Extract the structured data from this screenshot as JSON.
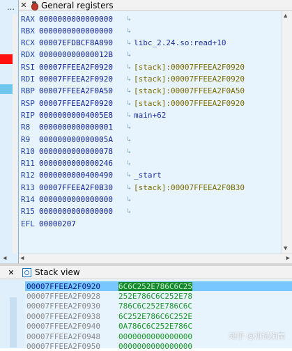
{
  "registers_panel": {
    "title": "General registers",
    "rows": [
      {
        "name": "RAX",
        "value": "0000000000000000",
        "note": ""
      },
      {
        "name": "RBX",
        "value": "0000000000000000",
        "note": ""
      },
      {
        "name": "RCX",
        "value": "00007EFDBCF8A890",
        "note": "libc_2.24.so:read+10"
      },
      {
        "name": "RDX",
        "value": "000000000000012B",
        "note": ""
      },
      {
        "name": "RSI",
        "value": "00007FFEEA2F0920",
        "note": "[stack]:00007FFEEA2F0920"
      },
      {
        "name": "RDI",
        "value": "00007FFEEA2F0920",
        "note": "[stack]:00007FFEEA2F0920"
      },
      {
        "name": "RBP",
        "value": "00007FFEEA2F0A50",
        "note": "[stack]:00007FFEEA2F0A50"
      },
      {
        "name": "RSP",
        "value": "00007FFEEA2F0920",
        "note": "[stack]:00007FFEEA2F0920"
      },
      {
        "name": "RIP",
        "value": "00000000004005E8",
        "note": "main+62"
      },
      {
        "name": "R8",
        "value": "0000000000000001",
        "note": ""
      },
      {
        "name": "R9",
        "value": "000000000000005A",
        "note": ""
      },
      {
        "name": "R10",
        "value": "0000000000000078",
        "note": ""
      },
      {
        "name": "R11",
        "value": "0000000000000246",
        "note": ""
      },
      {
        "name": "R12",
        "value": "0000000000400490",
        "note": "_start"
      },
      {
        "name": "R13",
        "value": "00007FFEEA2F0B30",
        "note": "[stack]:00007FFEEA2F0B30"
      },
      {
        "name": "R14",
        "value": "0000000000000000",
        "note": ""
      },
      {
        "name": "R15",
        "value": "0000000000000000",
        "note": ""
      },
      {
        "name": "EFL",
        "value": "00000207",
        "note": ""
      }
    ]
  },
  "stack_panel": {
    "title": "Stack view",
    "rows": [
      {
        "addr": "00007FFEEA2F0920",
        "value": "6C6C252E786C6C25"
      },
      {
        "addr": "00007FFEEA2F0928",
        "value": "252E786C6C252E78"
      },
      {
        "addr": "00007FFEEA2F0930",
        "value": "786C6C252E786C6C"
      },
      {
        "addr": "00007FFEEA2F0938",
        "value": "6C252E786C6C252E"
      },
      {
        "addr": "00007FFEEA2F0940",
        "value": "0A786C6C252E786C"
      },
      {
        "addr": "00007FFEEA2F0948",
        "value": "0000000000000000"
      },
      {
        "addr": "00007FFEEA2F0950",
        "value": "0000000000000000"
      }
    ]
  },
  "colors": {
    "selection": "#79c7ff",
    "highlight_value_bg": "#138a2c",
    "panel_bg": "#e8f4fd",
    "marker_red": "#ff1111",
    "marker_blue": "#6fc6ef"
  },
  "watermark": "知乎 @测试狗南",
  "icons": {
    "registers": "bug-icon",
    "stack": "stack-view-icon",
    "row_action": "jump-arrow-icon"
  }
}
